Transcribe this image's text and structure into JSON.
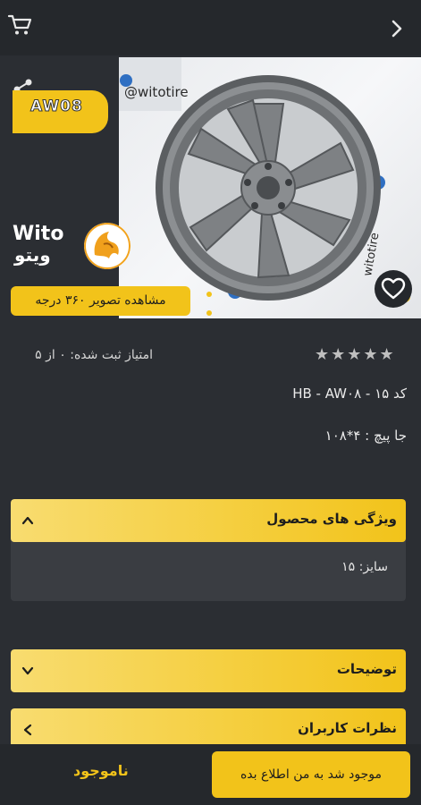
{
  "header": {
    "cart_icon": "cart-icon",
    "back_icon": "chevron-right-icon"
  },
  "hero": {
    "model_badge": "AW08",
    "view360_label": "مشاهده تصویر ۳۶۰ درجه",
    "watermark": "@witotire",
    "brand_latin": "Wito",
    "brand_persian": "ویتو",
    "icons": [
      "share-icon",
      "heart-icon"
    ]
  },
  "rating": {
    "stars": "★★★★★",
    "text": "امتیاز ثبت شده: ۰ از ۵"
  },
  "product": {
    "code_line": "کد ۱۵ - HB - AW۰۸",
    "bolt_line": "جا پیچ : ۴*۱۰۸"
  },
  "features": {
    "title": "ویژگی های محصول",
    "size_line": "سایز: ۱۵"
  },
  "description": {
    "title": "توضیحات"
  },
  "reviews": {
    "title": "نظرات کاربران"
  },
  "bottom": {
    "notify_label": "موجود شد به من اطلاع بده",
    "status": "ناموجود"
  },
  "colors": {
    "accent": "#f2c31a",
    "bg": "#2b2e33",
    "bar": "#25282c"
  }
}
